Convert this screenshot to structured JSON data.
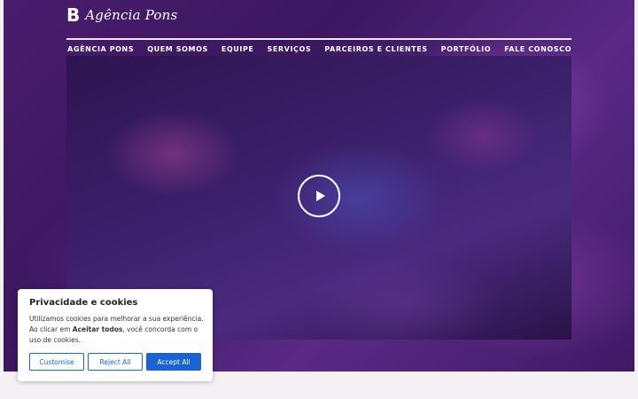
{
  "brand": {
    "mark": "B",
    "name": "Agência Pons"
  },
  "nav": {
    "items": [
      "AGÊNCIA PONS",
      "QUEM SOMOS",
      "EQUIPE",
      "SERVIÇOS",
      "PARCEIROS E CLIENTES",
      "PORTFÓLIO",
      "FALE CONOSCO"
    ]
  },
  "video": {
    "icon": "play-icon"
  },
  "cookie": {
    "title": "Privacidade e cookies",
    "text_before": "Utilizamos cookies para melhorar a sua experiência. Ao clicar em ",
    "text_bold": "Aceitar todos",
    "text_after": ", você concorda com o uso de cookies.",
    "customise_label": "Customise",
    "reject_label": "Reject All",
    "accept_label": "Accept All"
  },
  "colors": {
    "accent": "#1a63d1",
    "background": "#3a1760",
    "page": "#f3f1f3"
  }
}
